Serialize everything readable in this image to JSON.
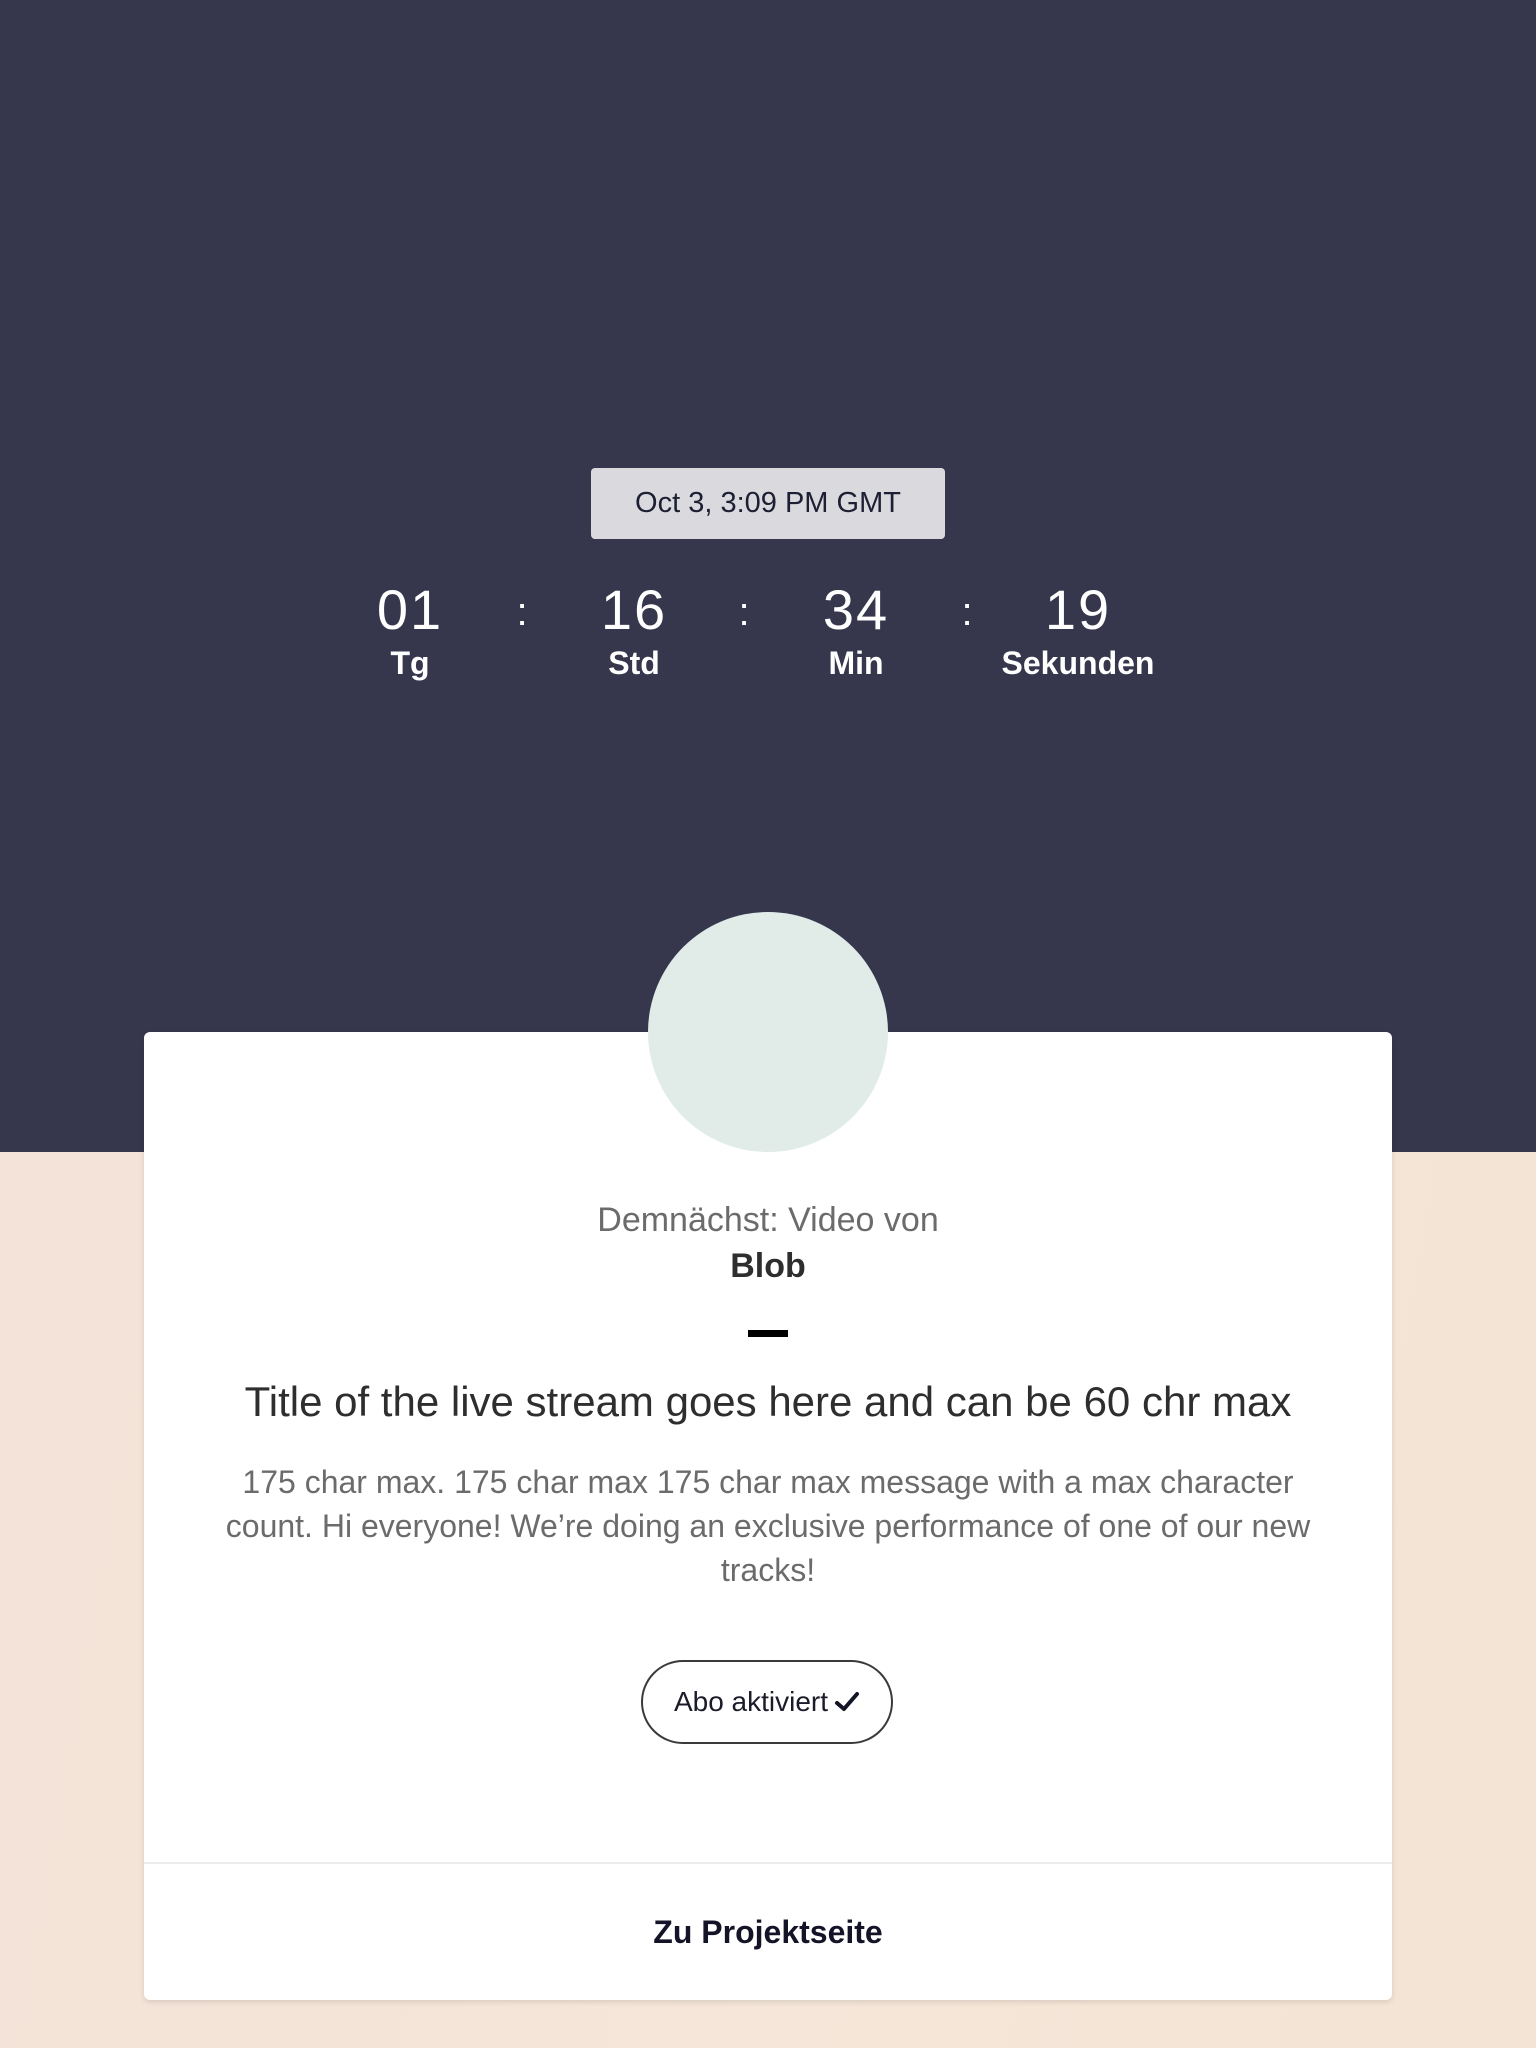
{
  "countdown": {
    "datetime": "Oct 3, 3:09 PM GMT",
    "separator": ":",
    "days": {
      "value": "01",
      "label": "Tg"
    },
    "hours": {
      "value": "16",
      "label": "Std"
    },
    "minutes": {
      "value": "34",
      "label": "Min"
    },
    "seconds": {
      "value": "19",
      "label": "Sekunden"
    }
  },
  "card": {
    "upcoming_label": "Demnächst: Video von",
    "artist": "Blob",
    "title": "Title of the live stream goes here and can be 60 chr max",
    "message": "175 char max. 175 char max 175 char max message with a max character count. Hi everyone! We’re doing an exclusive performance of one of our new tracks!",
    "subscribe_button": {
      "label": "Abo aktiviert",
      "icon": "check-icon"
    },
    "project_link": "Zu Projektseite"
  },
  "colors": {
    "hero_bg": "#36374c",
    "page_bg": "#f4e3d7",
    "avatar_bg": "#e1ebe8",
    "date_pill_bg": "#d9d9de"
  }
}
